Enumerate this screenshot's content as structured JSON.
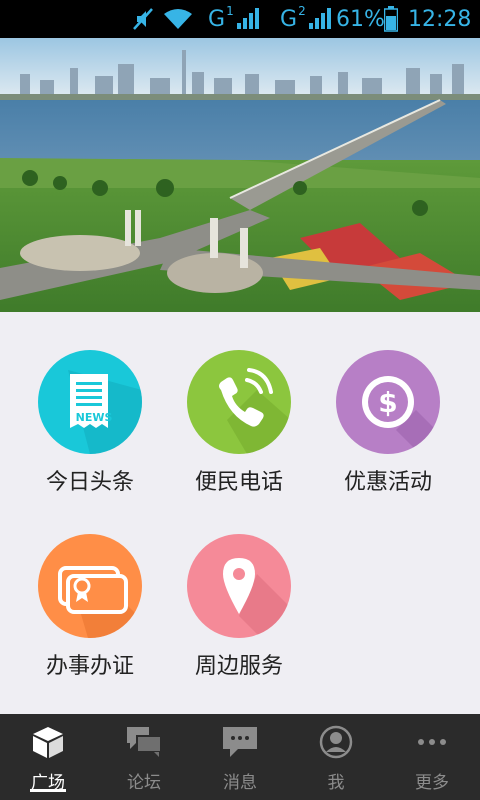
{
  "status_bar": {
    "sim1_network": "G",
    "sim1_index": "1",
    "sim2_network": "G",
    "sim2_index": "2",
    "battery": "61%",
    "time": "12:28",
    "icons": [
      "mute-icon",
      "wifi-icon",
      "signal-icon",
      "battery-icon"
    ],
    "color": "#37b4e6"
  },
  "banner": {
    "description_icon": "city-bridge-photo"
  },
  "grid": {
    "items": [
      {
        "label": "今日头条",
        "icon": "news-icon",
        "color": "#19c8d9",
        "badge": "NEWS"
      },
      {
        "label": "便民电话",
        "icon": "phone-icon",
        "color": "#8cc63e"
      },
      {
        "label": "优惠活动",
        "icon": "dollar-icon",
        "color": "#b77fc6"
      },
      {
        "label": "办事办证",
        "icon": "certificate-icon",
        "color": "#ff8e47"
      },
      {
        "label": "周边服务",
        "icon": "location-icon",
        "color": "#f58a98"
      }
    ]
  },
  "tabbar": {
    "tabs": [
      {
        "label": "广场",
        "icon": "cube-icon",
        "active": true
      },
      {
        "label": "论坛",
        "icon": "forum-icon",
        "active": false
      },
      {
        "label": "消息",
        "icon": "message-icon",
        "active": false
      },
      {
        "label": "我",
        "icon": "user-icon",
        "active": false
      },
      {
        "label": "更多",
        "icon": "more-icon",
        "active": false
      }
    ]
  }
}
